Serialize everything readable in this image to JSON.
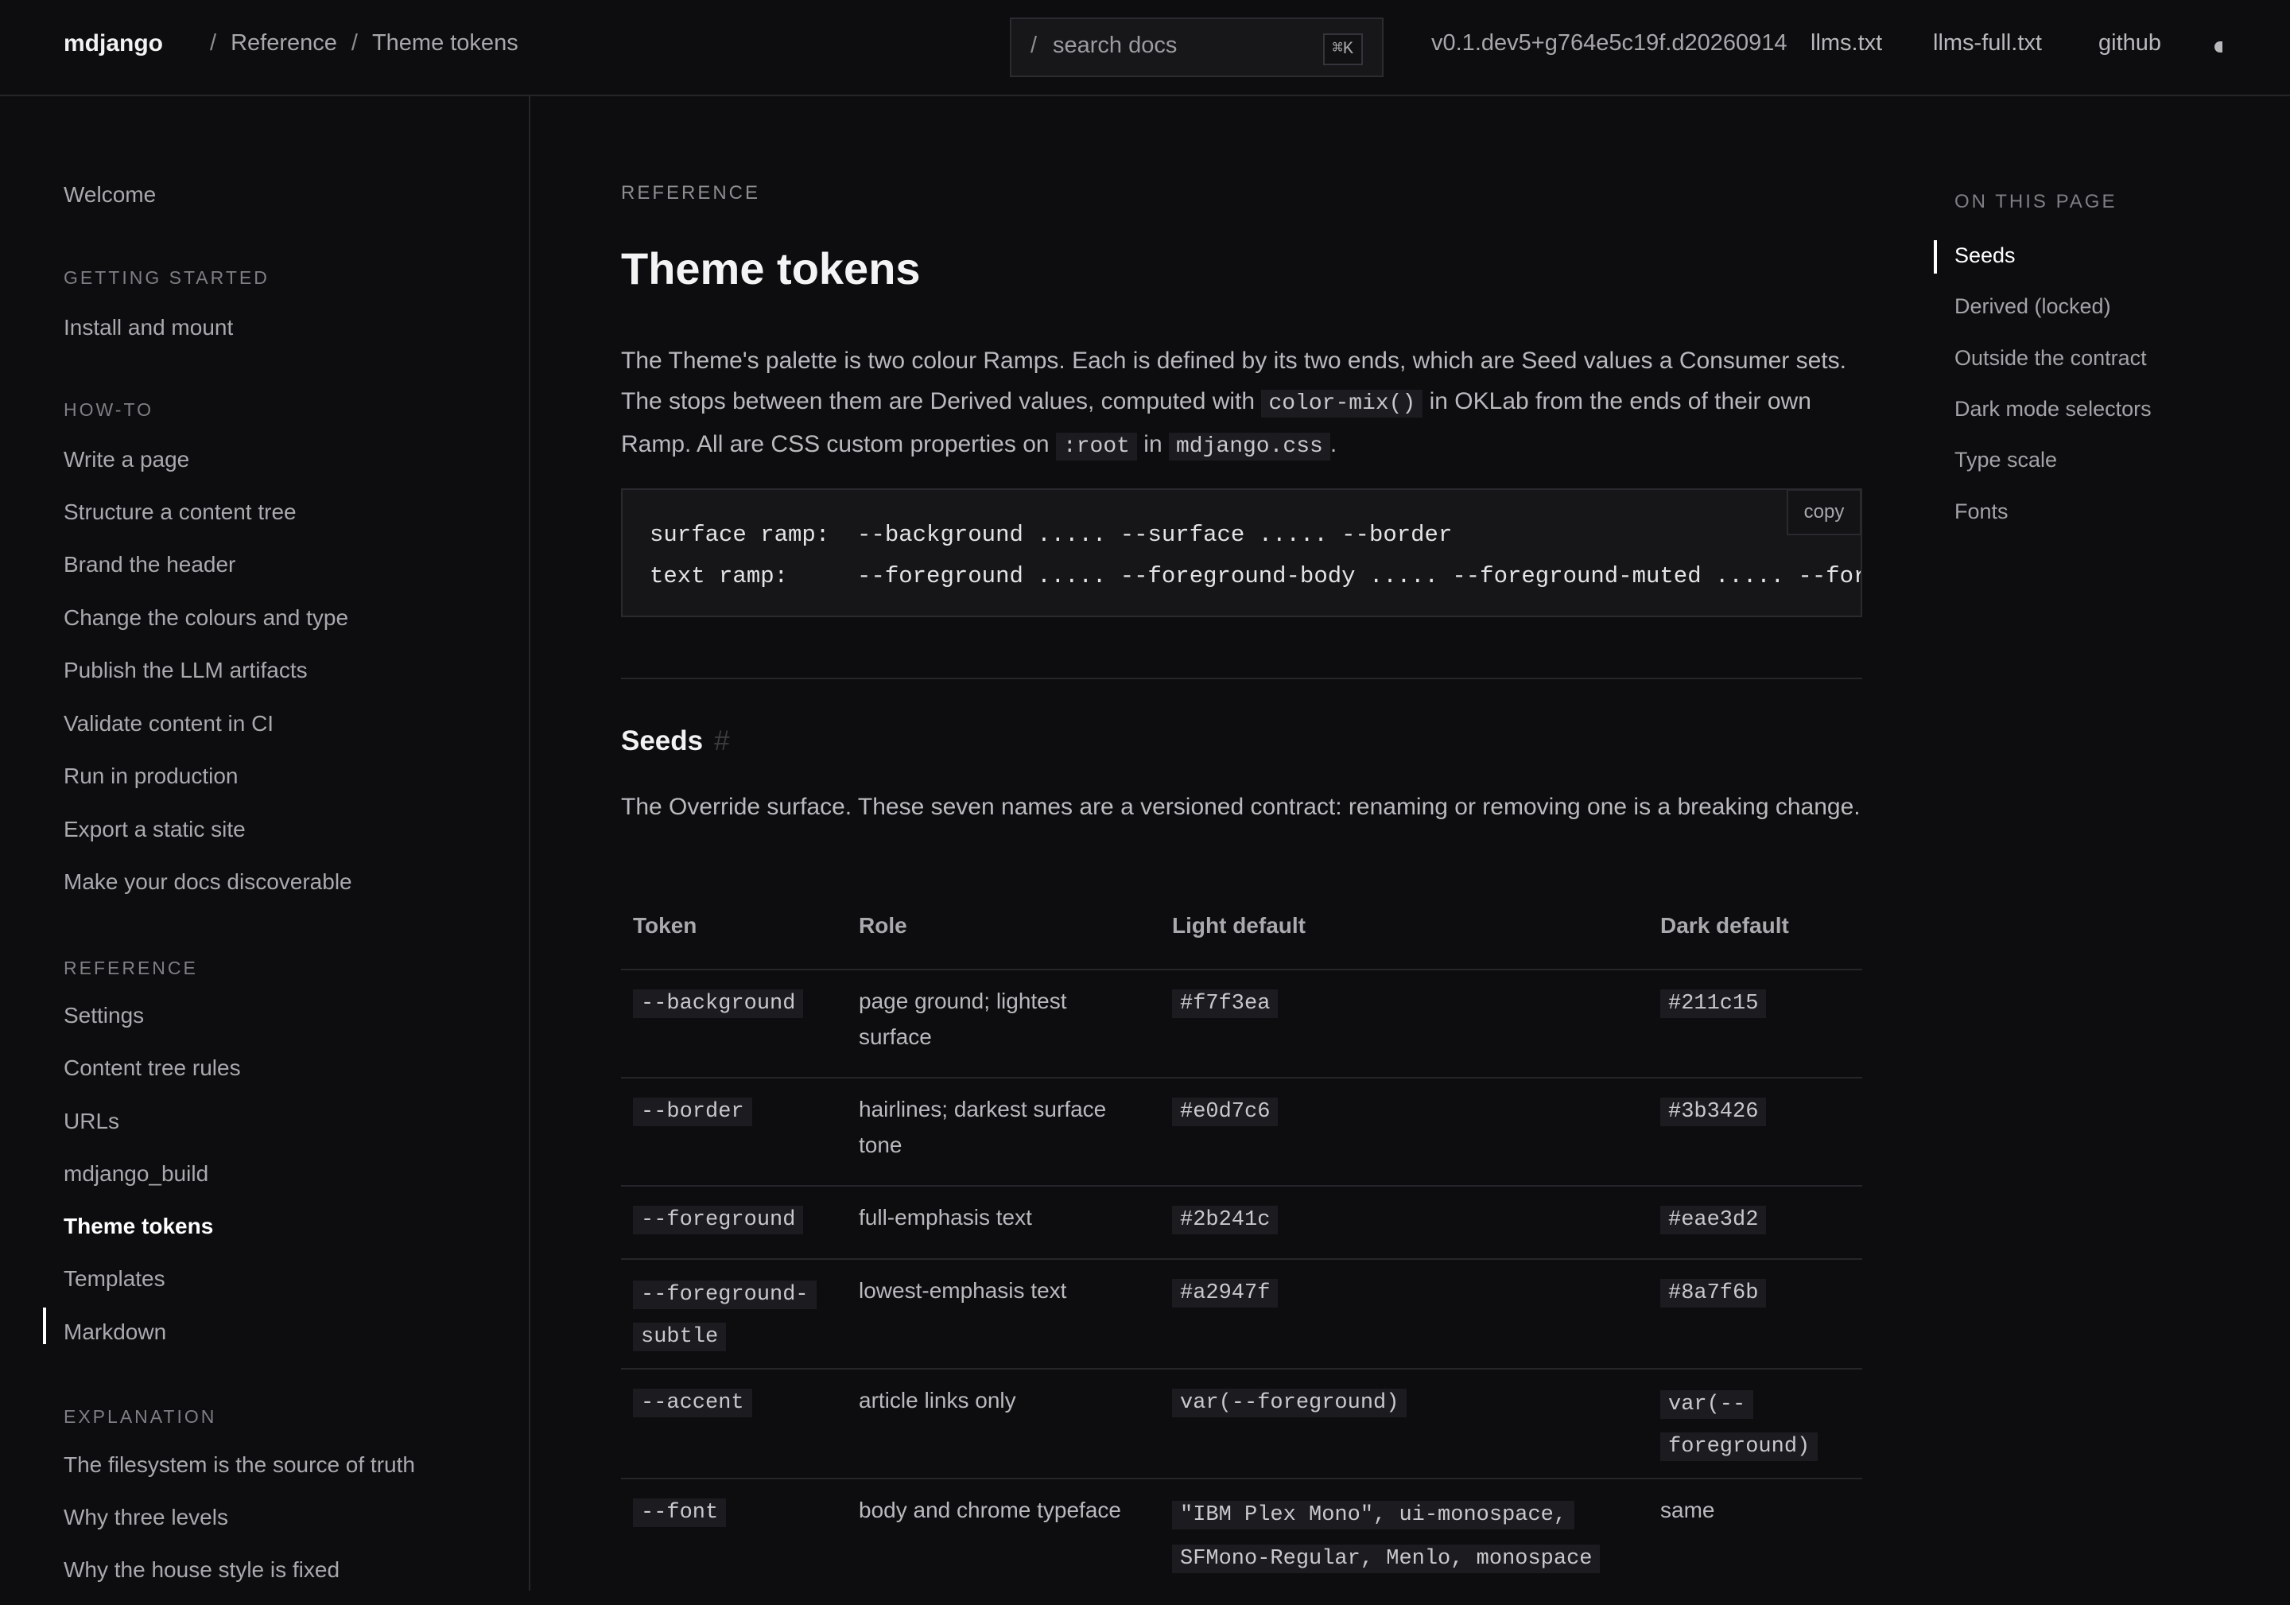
{
  "header": {
    "brand": "mdjango",
    "breadcrumb": [
      "Reference",
      "Theme tokens"
    ],
    "search": {
      "slash": "/",
      "placeholder": "search docs",
      "shortcut": "⌘K"
    },
    "version": "v0.1.dev5+g764e5c19f.d20260914",
    "links": [
      "llms.txt",
      "llms-full.txt",
      "github"
    ],
    "theme_toggle_icon": "moon-icon"
  },
  "sidebar": {
    "welcome": "Welcome",
    "sections": [
      {
        "title": "GETTING STARTED",
        "items": [
          "Install and mount"
        ]
      },
      {
        "title": "HOW-TO",
        "items": [
          "Write a page",
          "Structure a content tree",
          "Brand the header",
          "Change the colours and type",
          "Publish the LLM artifacts",
          "Validate content in CI",
          "Run in production",
          "Export a static site",
          "Make your docs discoverable"
        ]
      },
      {
        "title": "REFERENCE",
        "items": [
          "Settings",
          "Content tree rules",
          "URLs",
          "mdjango_build",
          "Theme tokens",
          "Templates",
          "Markdown"
        ]
      },
      {
        "title": "EXPLANATION",
        "items": [
          "The filesystem is the source of truth",
          "Why three levels",
          "Why the house style is fixed"
        ]
      }
    ],
    "active": "Theme tokens"
  },
  "main": {
    "eyebrow": "REFERENCE",
    "title": "Theme tokens",
    "intro": {
      "t1": "The Theme's palette is two colour Ramps. Each is defined by its two ends, which are Seed values a Consumer sets. The stops between them are Derived values, computed with",
      "c1": "color-mix()",
      "t2": "in OKLab from the ends of their own Ramp. All are CSS custom properties on",
      "c2": ":root",
      "t3": "in",
      "c3": "mdjango.css",
      "t4": "."
    },
    "code": {
      "line1": "surface ramp:  --background ..... --surface ..... --border",
      "line2": "text ramp:     --foreground ..... --foreground-body ..... --foreground-muted ..... --foreground",
      "copy_label": "copy"
    },
    "seeds": {
      "heading": "Seeds",
      "anchor": "#",
      "description": "The Override surface. These seven names are a versioned contract: renaming or removing one is a breaking change.",
      "columns": [
        "Token",
        "Role",
        "Light default",
        "Dark default"
      ],
      "rows": [
        {
          "token": "--background",
          "role": "page ground; lightest surface",
          "light": "#f7f3ea",
          "dark": "#211c15"
        },
        {
          "token": "--border",
          "role": "hairlines; darkest surface tone",
          "light": "#e0d7c6",
          "dark": "#3b3426"
        },
        {
          "token": "--foreground",
          "role": "full-emphasis text",
          "light": "#2b241c",
          "dark": "#eae3d2"
        },
        {
          "token": "--foreground-subtle",
          "role": "lowest-emphasis text",
          "light": "#a2947f",
          "dark": "#8a7f6b"
        },
        {
          "token": "--accent",
          "role": "article links only",
          "light": "var(--foreground)",
          "dark": "var(--foreground)"
        },
        {
          "token": "--font",
          "role": "body and chrome typeface",
          "light": "\"IBM Plex Mono\", ui-monospace, SFMono-Regular, Menlo, monospace",
          "dark": "same"
        }
      ]
    }
  },
  "toc": {
    "heading": "ON THIS PAGE",
    "items": [
      "Seeds",
      "Derived (locked)",
      "Outside the contract",
      "Dark mode selectors",
      "Type scale",
      "Fonts"
    ],
    "active": "Seeds"
  }
}
